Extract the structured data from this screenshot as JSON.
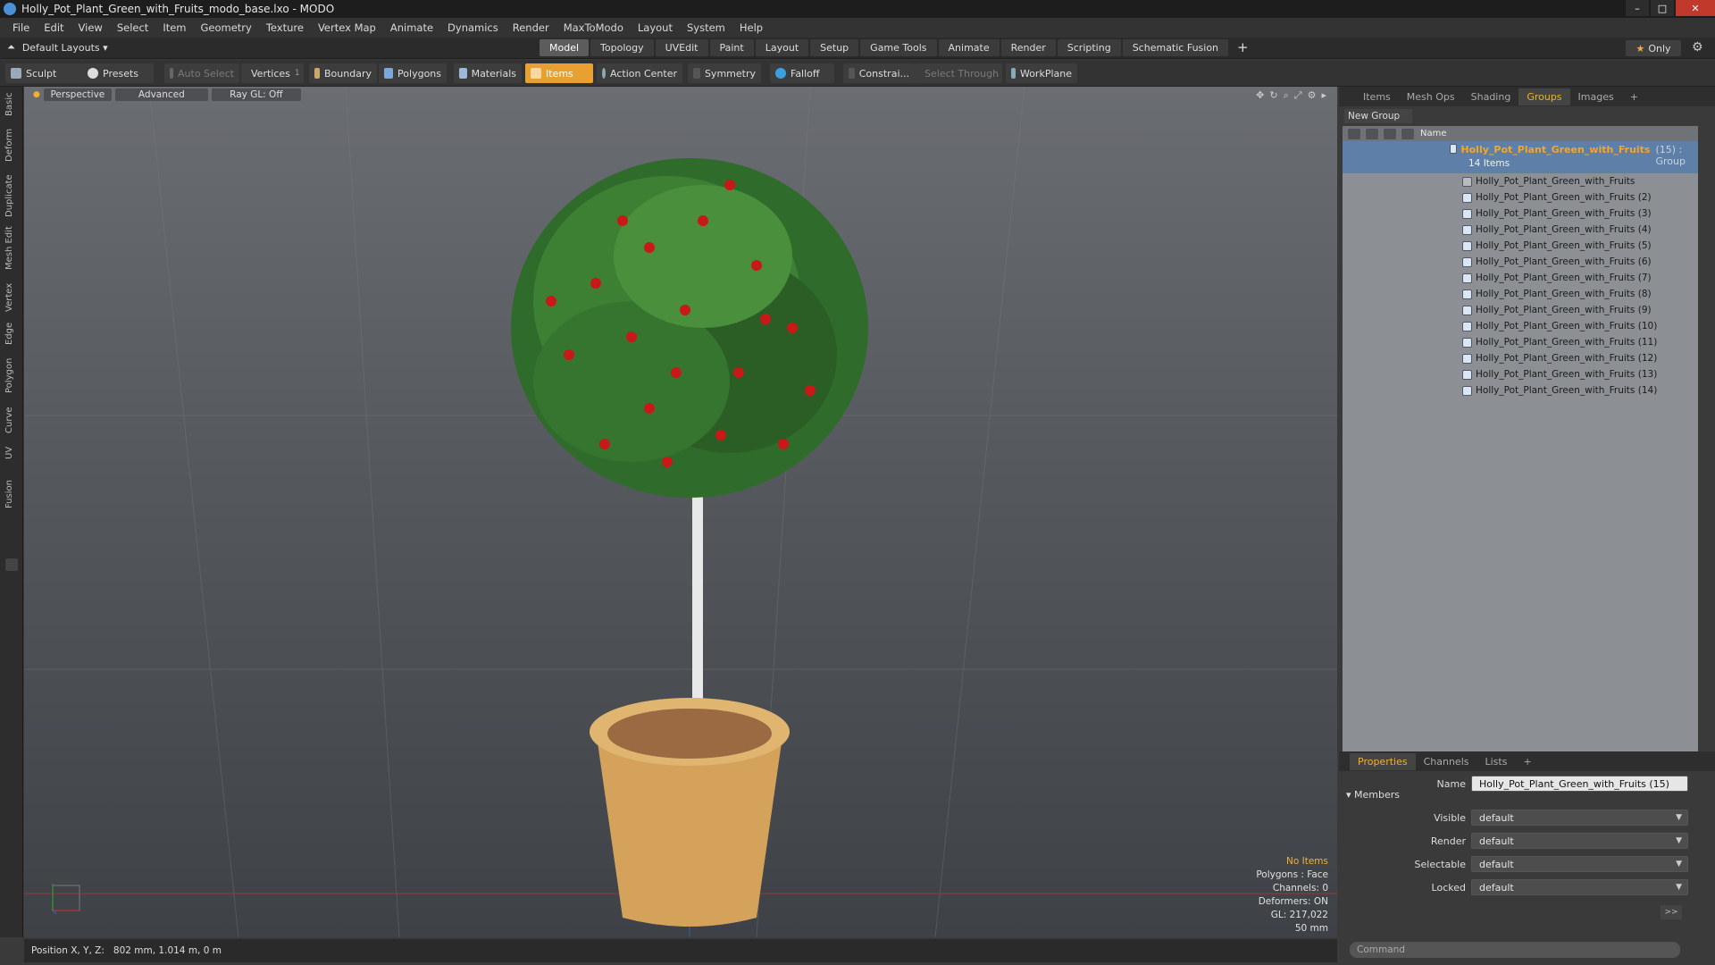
{
  "window": {
    "title": "Holly_Pot_Plant_Green_with_Fruits_modo_base.lxo - MODO",
    "min": "–",
    "max": "□",
    "close": "✕"
  },
  "menu": [
    "File",
    "Edit",
    "View",
    "Select",
    "Item",
    "Geometry",
    "Texture",
    "Vertex Map",
    "Animate",
    "Dynamics",
    "Render",
    "MaxToModo",
    "Layout",
    "System",
    "Help"
  ],
  "layouts": "Default Layouts ▾",
  "tabs": [
    "Model",
    "Topology",
    "UVEdit",
    "Paint",
    "Layout",
    "Setup",
    "Game Tools",
    "Animate",
    "Render",
    "Scripting",
    "Schematic Fusion"
  ],
  "active_tab": "Model",
  "only": {
    "label": "Only",
    "star": "★"
  },
  "toolbar": {
    "sculpt": "Sculpt",
    "presets": "Presets",
    "auto_select": "Auto Select",
    "vertices": "Vertices",
    "vert_count": "1",
    "boundary": "Boundary",
    "polygons": "Polygons",
    "materials": "Materials",
    "items": "Items",
    "action_center": "Action Center",
    "symmetry": "Symmetry",
    "falloff": "Falloff",
    "constraint": "Constrai...",
    "select_through": "Select Through",
    "workplane": "WorkPlane"
  },
  "left_tabs": [
    "Basic",
    "Deform",
    "Duplicate",
    "Mesh Edit",
    "Vertex",
    "Edge",
    "Polygon",
    "Curve",
    "UV",
    "Fusion"
  ],
  "viewport": {
    "view": "Perspective",
    "shading": "Advanced",
    "raygl": "Ray GL: Off"
  },
  "hud": {
    "selection": "No Items",
    "polygons": "Polygons : Face",
    "channels": "Channels: 0",
    "deformers": "Deformers: ON",
    "gl": "GL: 217,022",
    "lens": "50 mm"
  },
  "status": {
    "label": "Position X, Y, Z:",
    "value": "802 mm, 1.014 m, 0 m"
  },
  "right_tabs": [
    "Items",
    "Mesh Ops",
    "Shading",
    "Groups",
    "Images"
  ],
  "active_right_tab": "Groups",
  "new_group": "New Group",
  "tree": {
    "col_name": "Name",
    "group_name": "Holly_Pot_Plant_Green_with_Fruits",
    "group_count": "(15) : Group",
    "group_sub": "14 Items",
    "items": [
      "Holly_Pot_Plant_Green_with_Fruits",
      "Holly_Pot_Plant_Green_with_Fruits (2)",
      "Holly_Pot_Plant_Green_with_Fruits (3)",
      "Holly_Pot_Plant_Green_with_Fruits (4)",
      "Holly_Pot_Plant_Green_with_Fruits (5)",
      "Holly_Pot_Plant_Green_with_Fruits (6)",
      "Holly_Pot_Plant_Green_with_Fruits (7)",
      "Holly_Pot_Plant_Green_with_Fruits (8)",
      "Holly_Pot_Plant_Green_with_Fruits (9)",
      "Holly_Pot_Plant_Green_with_Fruits (10)",
      "Holly_Pot_Plant_Green_with_Fruits (11)",
      "Holly_Pot_Plant_Green_with_Fruits (12)",
      "Holly_Pot_Plant_Green_with_Fruits (13)",
      "Holly_Pot_Plant_Green_with_Fruits (14)"
    ]
  },
  "props": {
    "tabs": [
      "Properties",
      "Channels",
      "Lists"
    ],
    "name_label": "Name",
    "name_value": "Holly_Pot_Plant_Green_with_Fruits (15)",
    "members": "Members",
    "fields": [
      {
        "label": "Visible",
        "value": "default"
      },
      {
        "label": "Render",
        "value": "default"
      },
      {
        "label": "Selectable",
        "value": "default"
      },
      {
        "label": "Locked",
        "value": "default"
      }
    ],
    "more": ">>"
  },
  "command": "Command",
  "colors": {
    "accent": "#f0b030",
    "selection": "#5e7fa8"
  }
}
